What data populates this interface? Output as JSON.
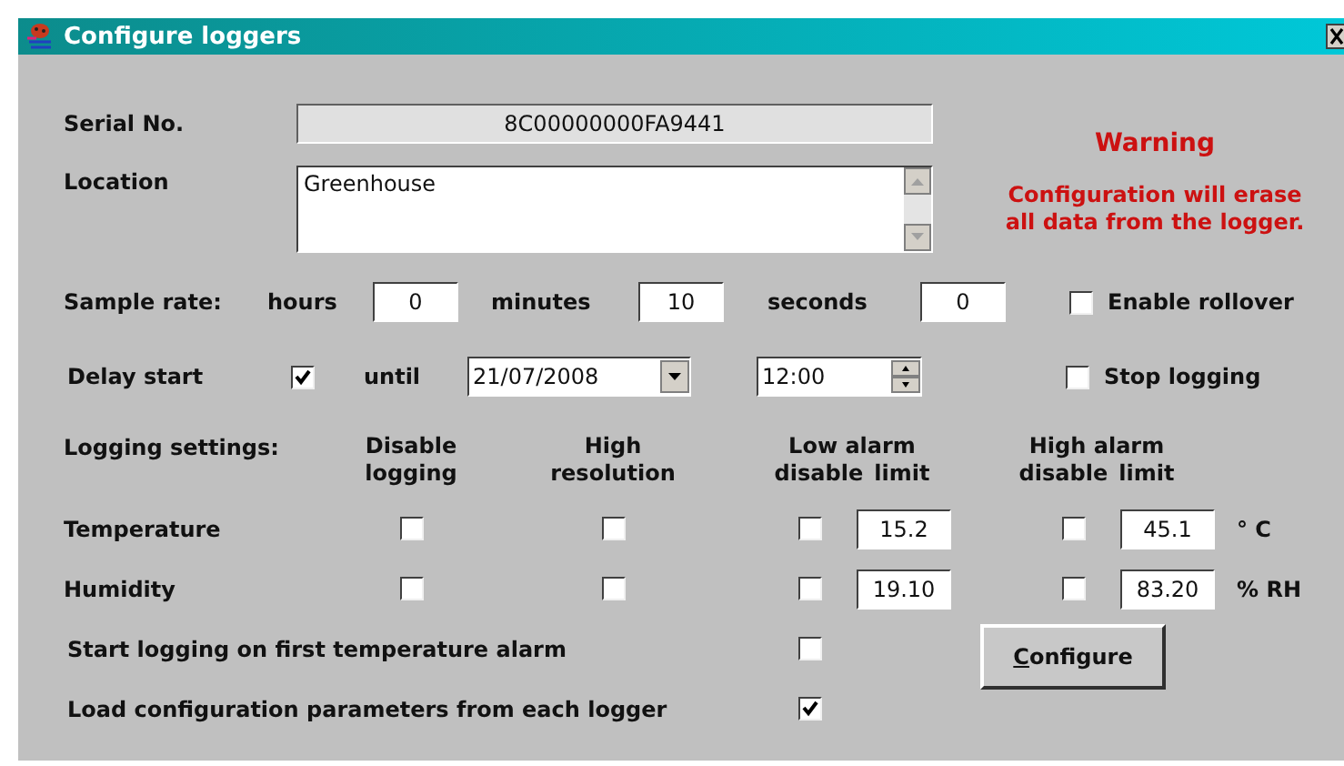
{
  "window": {
    "title": "Configure loggers"
  },
  "serial": {
    "label": "Serial No.",
    "value": "8C00000000FA9441"
  },
  "location": {
    "label": "Location",
    "value": "Greenhouse"
  },
  "warning": {
    "title": "Warning",
    "lines": [
      "Configuration will erase",
      "all data from the logger."
    ]
  },
  "sample_rate": {
    "label": "Sample rate:",
    "fields": [
      {
        "label": "hours",
        "value": "0"
      },
      {
        "label": "minutes",
        "value": "10"
      },
      {
        "label": "seconds",
        "value": "0"
      }
    ]
  },
  "rollover": {
    "label": "Enable rollover",
    "checked": false
  },
  "delay": {
    "label": "Delay start",
    "checked": true,
    "until_label": "until",
    "date": "21/07/2008",
    "time": "12:00"
  },
  "stop_logging": {
    "label": "Stop logging",
    "checked": false
  },
  "logging": {
    "label": "Logging settings:",
    "headers": [
      {
        "top": "Disable",
        "bottom": [
          "logging"
        ]
      },
      {
        "top": "High",
        "bottom": [
          "resolution"
        ]
      },
      {
        "top": "Low alarm",
        "bottom": [
          "disable",
          "limit"
        ]
      },
      {
        "top": "High alarm",
        "bottom": [
          "disable",
          "limit"
        ]
      }
    ],
    "rows": [
      {
        "name": "Temperature",
        "disable_logging": false,
        "high_resolution": false,
        "low_disable": false,
        "low_limit": "15.2",
        "high_disable": false,
        "high_limit": "45.1",
        "unit": "° C"
      },
      {
        "name": "Humidity",
        "disable_logging": false,
        "high_resolution": false,
        "low_disable": false,
        "low_limit": "19.10",
        "high_disable": false,
        "high_limit": "83.20",
        "unit": "% RH"
      }
    ]
  },
  "flags": [
    {
      "label": "Start logging on first temperature alarm",
      "checked": false
    },
    {
      "label": "Load configuration parameters from each logger",
      "checked": true
    }
  ],
  "button": {
    "access_key": "C",
    "rest": "onfigure"
  }
}
